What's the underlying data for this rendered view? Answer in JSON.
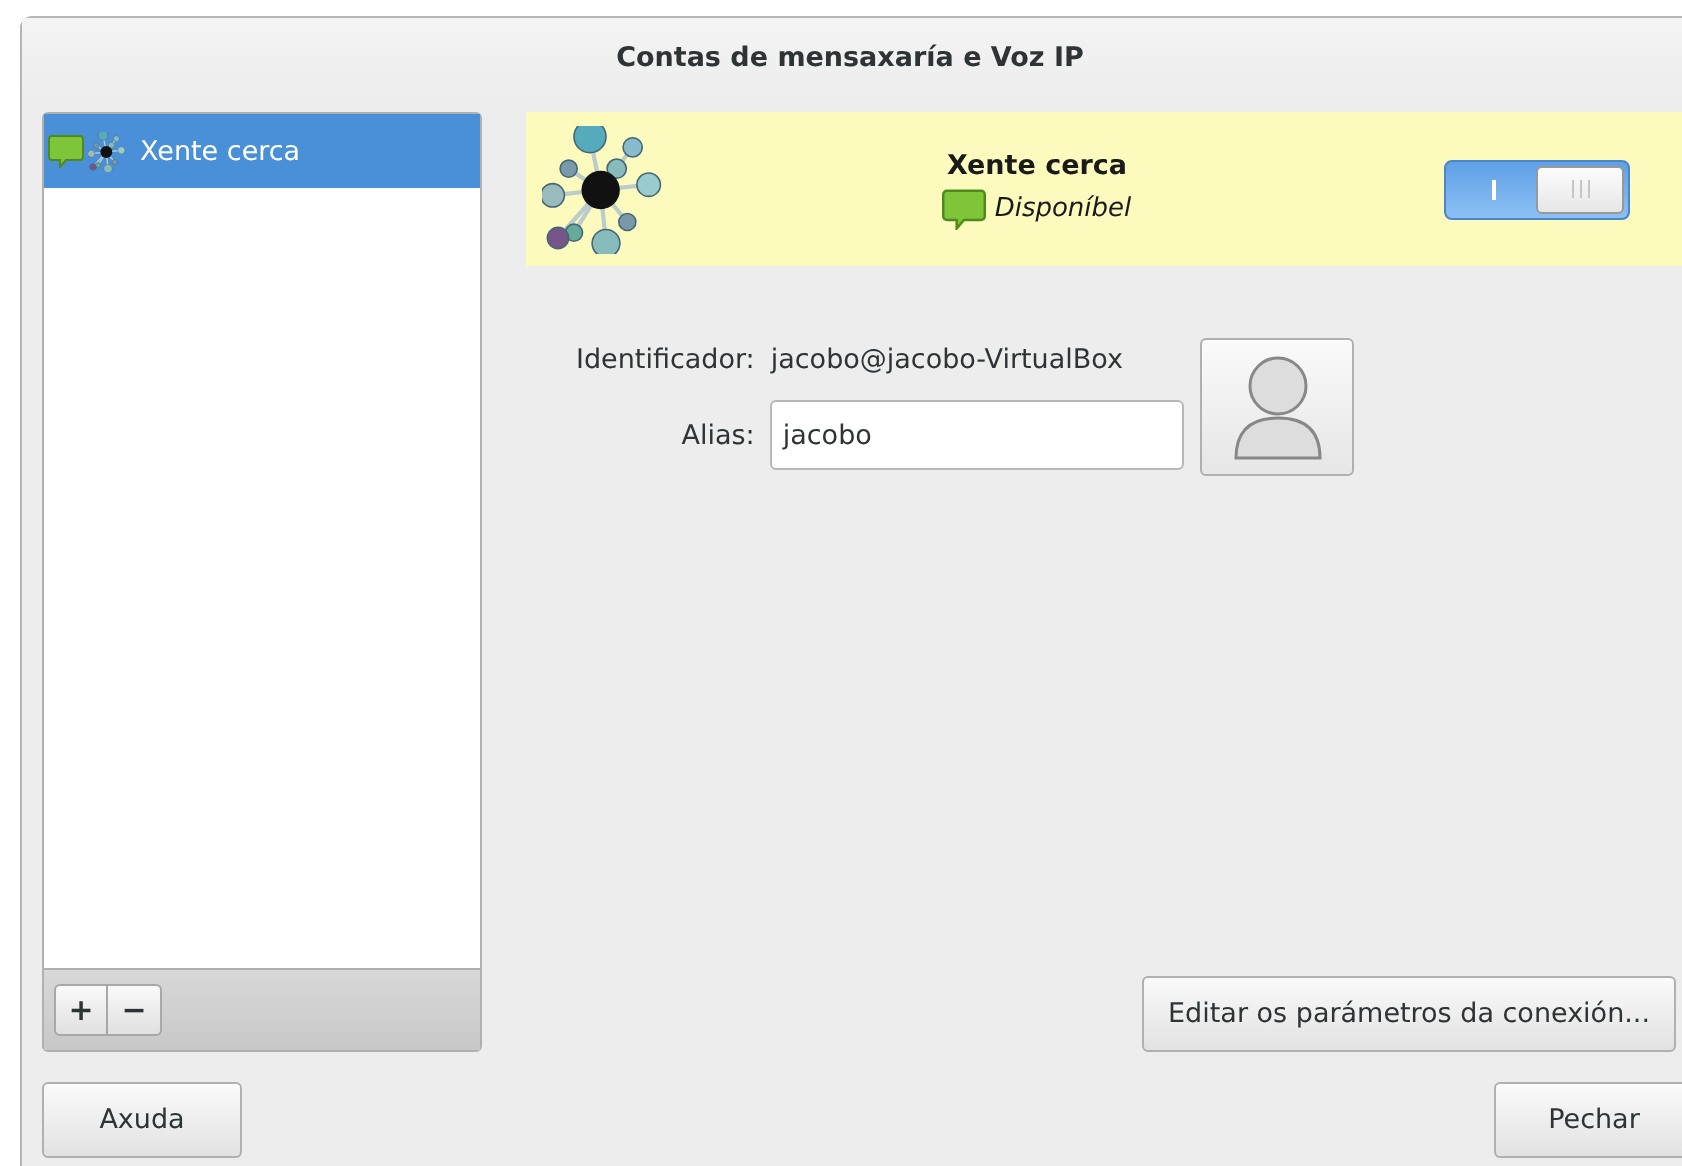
{
  "window": {
    "title": "Contas de mensaxaría e Voz IP"
  },
  "accounts": [
    {
      "name": "Xente cerca",
      "selected": true
    }
  ],
  "list_toolbar": {
    "buttons": [
      "+",
      "−"
    ]
  },
  "account": {
    "name": "Xente cerca",
    "status": "Disponíbel",
    "enabled": true,
    "identifier_label": "Identificador:",
    "identifier": "jacobo@jacobo-VirtualBox",
    "alias_label": "Alias:",
    "alias": "jacobo"
  },
  "edit_button": "Editar os parámetros da conexión...",
  "buttons": [
    {
      "kind": "help",
      "label": "Axuda"
    },
    {
      "kind": "close",
      "label": "Pechar"
    }
  ]
}
